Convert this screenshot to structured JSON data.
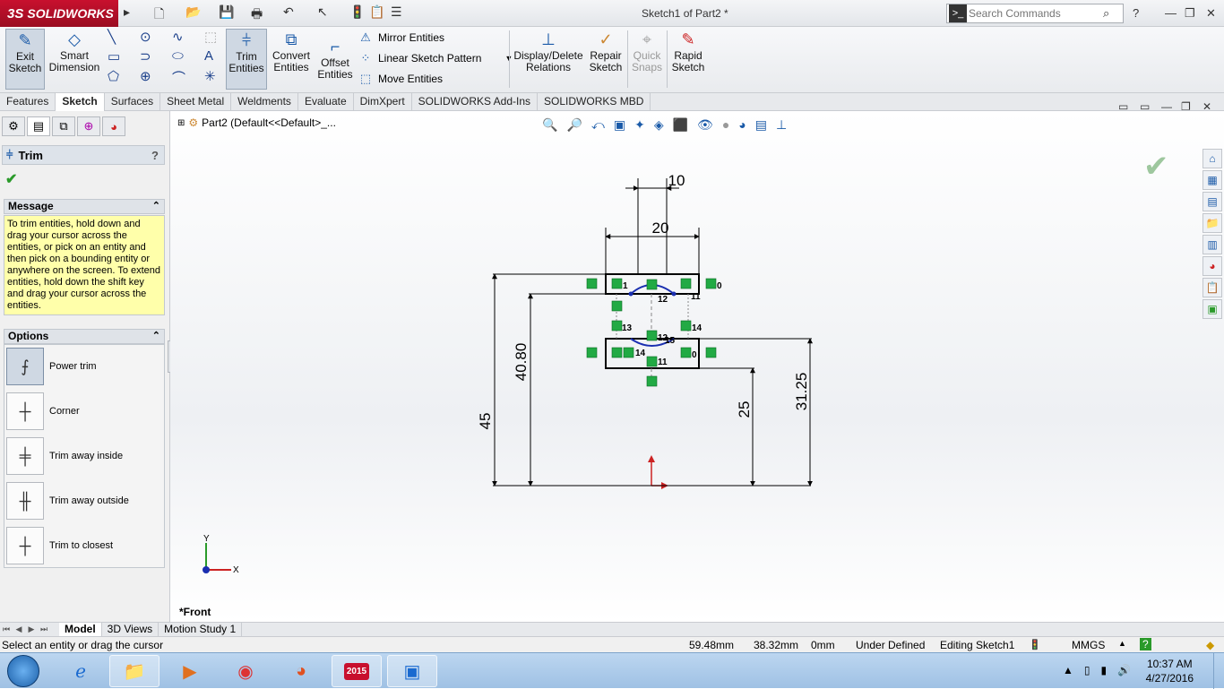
{
  "app": {
    "brand": "SOLIDWORKS",
    "brand_prefix": "3S",
    "document_title": "Sketch1 of Part2 *"
  },
  "search": {
    "placeholder": "Search Commands"
  },
  "command_manager": {
    "exit_sketch": "Exit Sketch",
    "smart_dimension": "Smart Dimension",
    "trim_entities": "Trim Entities",
    "convert_entities": "Convert Entities",
    "offset_entities": "Offset Entities",
    "mirror_entities": "Mirror Entities",
    "linear_sketch_pattern": "Linear Sketch Pattern",
    "move_entities": "Move Entities",
    "display_delete_relations": "Display/Delete Relations",
    "repair_sketch": "Repair Sketch",
    "quick_snaps": "Quick Snaps",
    "rapid_sketch": "Rapid Sketch"
  },
  "tabs": [
    "Features",
    "Sketch",
    "Surfaces",
    "Sheet Metal",
    "Weldments",
    "Evaluate",
    "DimXpert",
    "SOLIDWORKS Add-Ins",
    "SOLIDWORKS MBD"
  ],
  "active_tab": "Sketch",
  "property_manager": {
    "title": "Trim",
    "help": "?",
    "message_header": "Message",
    "message": "To trim entities, hold down and drag your cursor across the entities, or pick on an entity and then pick on a bounding entity or anywhere on the screen.  To extend entities, hold down the shift key and drag your cursor across the entities.",
    "options_header": "Options",
    "options": [
      {
        "label": "Power trim",
        "icon": "power-trim-icon",
        "selected": true
      },
      {
        "label": "Corner",
        "icon": "corner-icon",
        "selected": false
      },
      {
        "label": "Trim away inside",
        "icon": "trim-inside-icon",
        "selected": false
      },
      {
        "label": "Trim away outside",
        "icon": "trim-outside-icon",
        "selected": false
      },
      {
        "label": "Trim to closest",
        "icon": "trim-closest-icon",
        "selected": false
      }
    ]
  },
  "graphics": {
    "tree_root": "Part2  (Default<<Default>_...",
    "view_label": "*Front",
    "dimensions": {
      "d10": "10",
      "d20": "20",
      "d45": "45",
      "d4080": "40.80",
      "d25": "25",
      "d3125": "31.25"
    },
    "relation_tags": [
      "1",
      "0",
      "12",
      "11",
      "13",
      "14",
      "12",
      "15",
      "14",
      "0",
      "11"
    ],
    "axis_x": "X",
    "axis_y": "Y"
  },
  "bottom_tabs": [
    "Model",
    "3D Views",
    "Motion Study 1"
  ],
  "status": {
    "message": "Select an entity or drag the cursor",
    "x": "59.48mm",
    "y": "38.32mm",
    "z": "0mm",
    "definition": "Under Defined",
    "editing": "Editing Sketch1",
    "units": "MMGS"
  },
  "taskbar": {
    "time": "10:37 AM",
    "date": "4/27/2016",
    "sw_version": "2015"
  },
  "colors": {
    "accent": "#1a5aa8",
    "brand": "#c8102e",
    "relation_green": "#22aa44",
    "sketch_blue": "#1a2fb0"
  }
}
